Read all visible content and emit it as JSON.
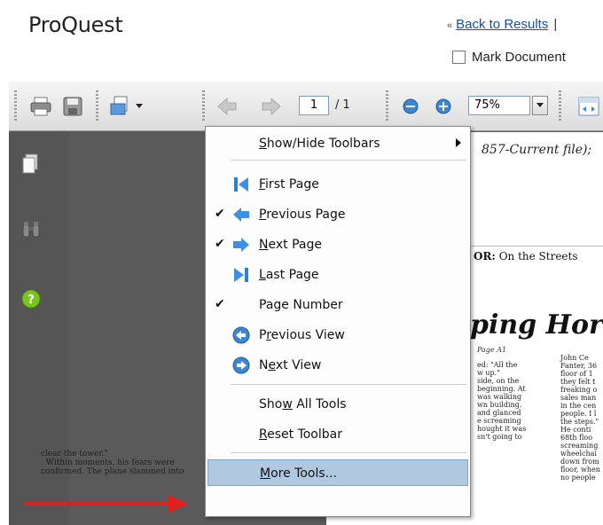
{
  "header": {
    "logo": "ProQuest",
    "back_chevron": "«",
    "back_link": "Back to Results",
    "separator": "|",
    "mark_document": "Mark Document"
  },
  "toolbar": {
    "page_current": "1",
    "page_total": "/ 1",
    "zoom": "75%"
  },
  "menu": {
    "items": [
      {
        "label_pre": "",
        "label_u": "S",
        "label_post": "how/Hide Toolbars",
        "checked": false,
        "icon": "",
        "submenu": true
      },
      {
        "label_pre": "",
        "label_u": "F",
        "label_post": "irst Page",
        "checked": false,
        "icon": "first-page-icon",
        "submenu": false
      },
      {
        "label_pre": "",
        "label_u": "P",
        "label_post": "revious Page",
        "checked": true,
        "icon": "previous-page-icon",
        "submenu": false
      },
      {
        "label_pre": "",
        "label_u": "N",
        "label_post": "ext Page",
        "checked": true,
        "icon": "next-page-icon",
        "submenu": false
      },
      {
        "label_pre": "",
        "label_u": "L",
        "label_post": "ast Page",
        "checked": false,
        "icon": "last-page-icon",
        "submenu": false
      },
      {
        "label_pre": "Page Number",
        "label_u": "",
        "label_post": "",
        "checked": true,
        "icon": "",
        "submenu": false
      },
      {
        "label_pre": "P",
        "label_u": "r",
        "label_post": "evious View",
        "checked": false,
        "icon": "previous-view-icon",
        "submenu": false
      },
      {
        "label_pre": "N",
        "label_u": "e",
        "label_post": "xt View",
        "checked": false,
        "icon": "next-view-icon",
        "submenu": false
      },
      {
        "label_pre": "Sho",
        "label_u": "w",
        "label_post": " All Tools",
        "checked": false,
        "icon": "",
        "submenu": false
      },
      {
        "label_pre": "",
        "label_u": "R",
        "label_post": "eset Toolbar",
        "checked": false,
        "icon": "",
        "submenu": false
      },
      {
        "label_pre": "",
        "label_u": "M",
        "label_post": "ore Tools...",
        "checked": false,
        "icon": "",
        "submenu": false
      }
    ],
    "check_mark": "✔"
  },
  "document": {
    "citation": "857-Current file);",
    "author_label": "OR:",
    "author_text": "On the Streets",
    "headline": "ping Hor",
    "byline": "Page A1",
    "col_left": "ed: \"All the\nw up.\"\nside, on the\nbeginning. At\nwas walking\nwn building.\nand glanced\ne screaming\nhought it was\nsn't going to",
    "col_right": "John Ce\nFanter, 36\nfloor of 1\nthey felt t\nfreaking o\nsales man\nin the cen\npeople. I l\nthe steps.\"\nHe conti\n68th floo\nscreaming\nwheelchai\ndown from\nfloor, when\nno people",
    "body_lines": "clear the tower.\"\n  Within moments, his fears were\nconfirmed. The plane slammed into"
  },
  "colors": {
    "menu_highlight": "#b0c9e0",
    "arrow": "#e21f1f",
    "link": "#1a4fa0"
  }
}
